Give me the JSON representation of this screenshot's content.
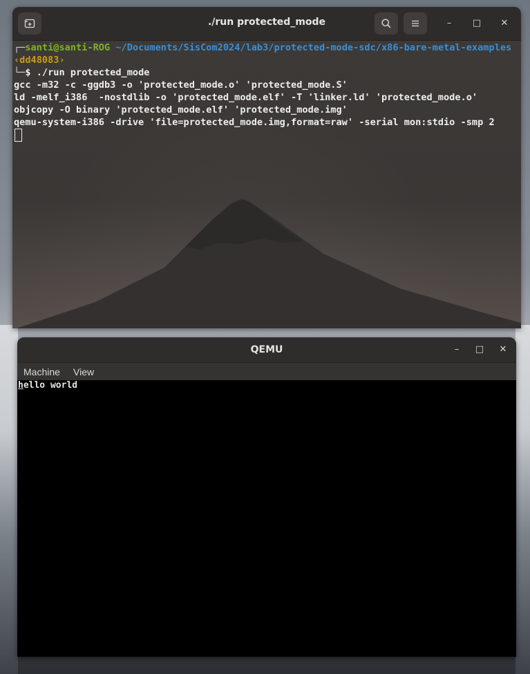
{
  "terminal": {
    "title": "./run protected_mode",
    "buttons": {
      "new_tab_icon": "new-tab-icon",
      "search_icon": "search-icon",
      "menu_icon": "hamburger-menu-icon"
    },
    "window_controls": {
      "minimize": "–",
      "maximize": "□",
      "close": "✕"
    },
    "prompt": {
      "corner_top": "┌─",
      "user_host": "santi@santi-ROG",
      "path": "~/Documents/SisCom2024/lab3/protected-mode-sdc/x86-bare-metal-examples",
      "git": "‹dd48083›",
      "corner_bottom": "└─",
      "symbol": "$",
      "command": "./run protected_mode"
    },
    "output_lines": [
      "gcc -m32 -c -ggdb3 -o 'protected_mode.o' 'protected_mode.S'",
      "ld -melf_i386  -nostdlib -o 'protected_mode.elf' -T 'linker.ld' 'protected_mode.o'",
      "objcopy -O binary 'protected_mode.elf' 'protected_mode.img'",
      "qemu-system-i386 -drive 'file=protected_mode.img,format=raw' -serial mon:stdio -smp 2"
    ]
  },
  "qemu": {
    "title": "QEMU",
    "window_controls": {
      "minimize": "–",
      "maximize": "□",
      "close": "✕"
    },
    "menu": [
      "Machine",
      "View"
    ],
    "screen_text_first": "h",
    "screen_text_rest": "ello world"
  },
  "colors": {
    "prompt_green": "#7fb520",
    "path_blue": "#3a8fd6",
    "git_yellow": "#c89b1a",
    "terminal_bg": "#3b3836",
    "header_bg": "#2e2c2b"
  }
}
